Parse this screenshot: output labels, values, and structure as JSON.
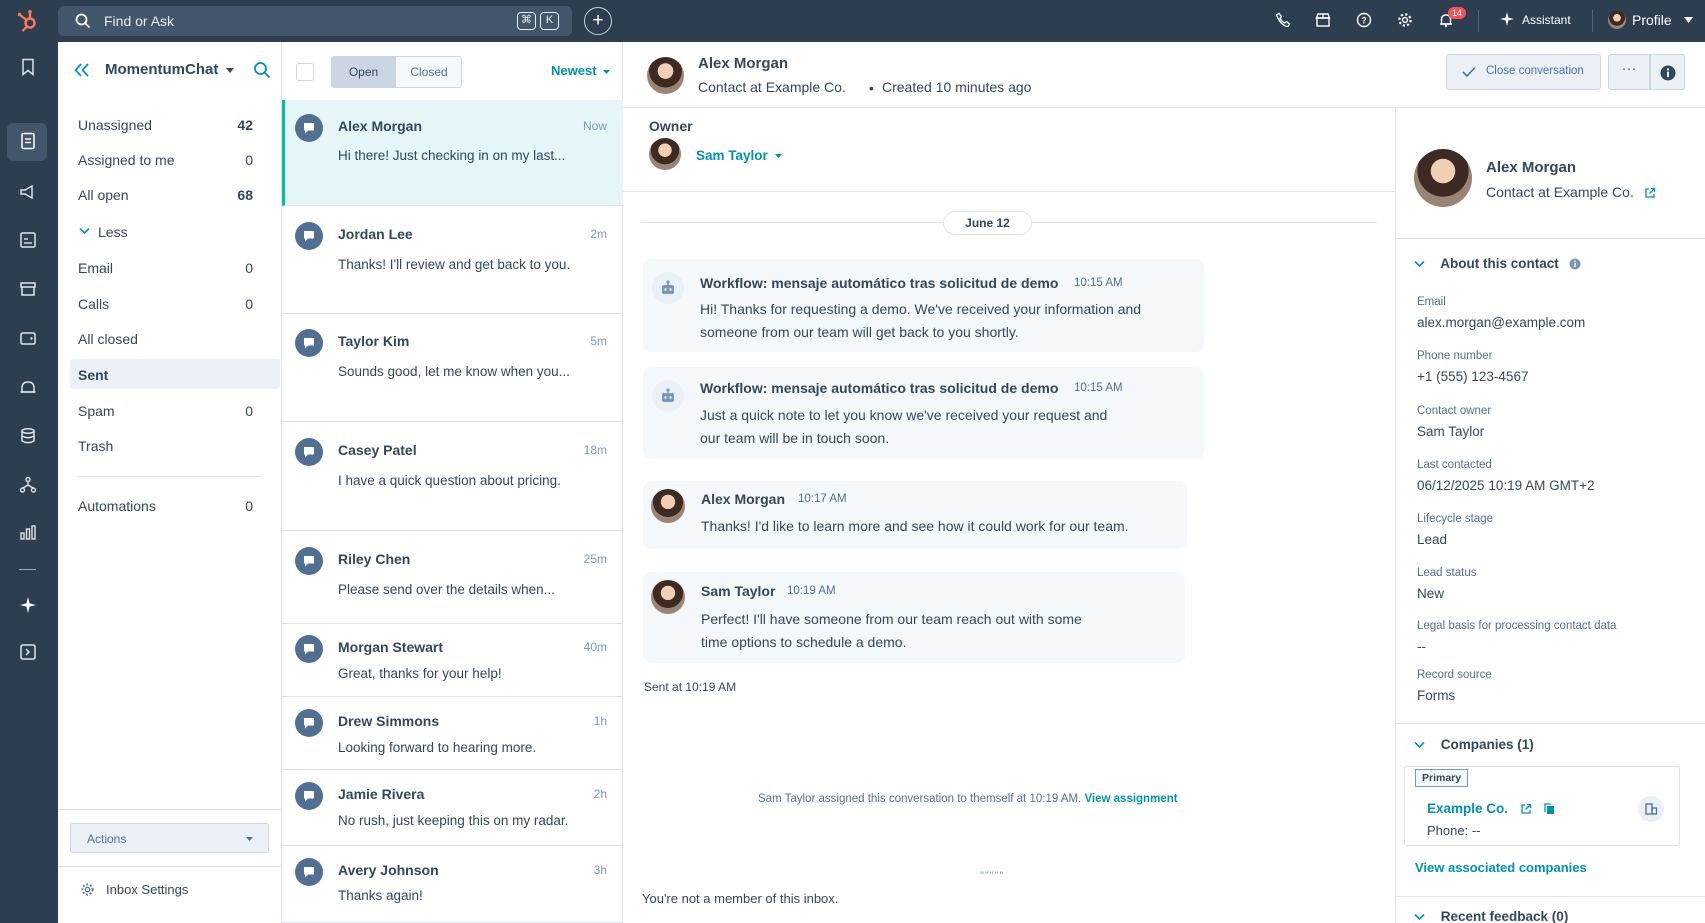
{
  "topbar": {
    "search_placeholder": "Find or Ask",
    "kbd_cmd": "⌘",
    "kbd_k": "K",
    "notifications_count": "14",
    "assistant_label": "Assistant",
    "profile_label": "Profile"
  },
  "sidebar": {
    "inbox_name": "MomentumChat",
    "items": [
      {
        "label": "Unassigned",
        "count": "42"
      },
      {
        "label": "Assigned to me",
        "count": "0"
      },
      {
        "label": "All open",
        "count": "68"
      },
      {
        "label": "Less",
        "count": ""
      },
      {
        "label": "Email",
        "count": "0"
      },
      {
        "label": "Calls",
        "count": "0"
      },
      {
        "label": "All closed",
        "count": ""
      },
      {
        "label": "Sent",
        "count": ""
      },
      {
        "label": "Spam",
        "count": "0"
      },
      {
        "label": "Trash",
        "count": ""
      },
      {
        "label": "Automations",
        "count": "0"
      }
    ],
    "actions_label": "Actions",
    "settings_label": "Inbox Settings"
  },
  "conv_list": {
    "tab_open": "Open",
    "tab_closed": "Closed",
    "sort_label": "Newest",
    "items": [
      {
        "name": "Alex Morgan",
        "time": "Now",
        "preview": "Hi there! Just checking in on my last..."
      },
      {
        "name": "Jordan Lee",
        "time": "2m",
        "preview": "Thanks! I'll review and get back to you."
      },
      {
        "name": "Taylor Kim",
        "time": "5m",
        "preview": "Sounds good, let me know when you..."
      },
      {
        "name": "Casey Patel",
        "time": "18m",
        "preview": "I have a quick question about pricing."
      },
      {
        "name": "Riley Chen",
        "time": "25m",
        "preview": "Please send over the details when..."
      },
      {
        "name": "Morgan Stewart",
        "time": "40m",
        "preview": "Great, thanks for your help!"
      },
      {
        "name": "Drew Simmons",
        "time": "1h",
        "preview": "Looking forward to hearing more."
      },
      {
        "name": "Jamie Rivera",
        "time": "2h",
        "preview": "No rush, just keeping this on my radar."
      },
      {
        "name": "Avery Johnson",
        "time": "3h",
        "preview": "Thanks again!"
      }
    ]
  },
  "thread": {
    "contact_name": "Alex Morgan",
    "contact_meta": "Contact at Example Co.",
    "created": "Created 10 minutes ago",
    "close_label": "Close conversation",
    "more_label": "···",
    "owner_label": "Owner",
    "owner_name": "Sam Taylor",
    "date_pill": "June 12",
    "messages": [
      {
        "sender": "Workflow: mensaje automático tras solicitud de demo",
        "time": "10:15 AM",
        "body": [
          "Hi! Thanks for requesting a demo. We've received your information and",
          "someone from our team will get back to you shortly."
        ]
      },
      {
        "sender": "Workflow: mensaje automático tras solicitud de demo",
        "time": "10:15 AM",
        "body": [
          "Just a quick note to let you know we've received your request and",
          "our team will be in touch soon."
        ]
      },
      {
        "sender": "Alex Morgan",
        "time": "10:17 AM",
        "body": [
          "Thanks! I'd like to learn more and see how it could work for our team."
        ]
      },
      {
        "sender": "Sam Taylor",
        "time": "10:19 AM",
        "body": [
          "Perfect! I'll have someone from our team reach out with some",
          "time options to schedule a demo."
        ]
      }
    ],
    "sent_at": "Sent at 10:19 AM",
    "assignment_text": "Sam Taylor assigned this conversation to themself at 10:19 AM.",
    "assignment_link": "View assignment",
    "resize_glyph": "\"\"\"\"\"",
    "not_member": "You're not a member of this inbox."
  },
  "contact_panel": {
    "name": "Alex Morgan",
    "meta": "Contact at Example Co.",
    "about_title": "About this contact",
    "fields": [
      {
        "label": "Email",
        "value": "alex.morgan@example.com"
      },
      {
        "label": "Phone number",
        "value": "+1 (555) 123-4567"
      },
      {
        "label": "Contact owner",
        "value": "Sam Taylor"
      },
      {
        "label": "Last contacted",
        "value": "06/12/2025 10:19 AM GMT+2"
      },
      {
        "label": "Lifecycle stage",
        "value": "Lead"
      },
      {
        "label": "Lead status",
        "value": "New"
      },
      {
        "label": "Legal basis for processing contact data",
        "value": "--"
      },
      {
        "label": "Record source",
        "value": "Forms"
      }
    ],
    "companies_title": "Companies (1)",
    "primary_tag": "Primary",
    "company_name": "Example Co.",
    "company_phone": "Phone: --",
    "view_companies": "View associated companies",
    "feedback_title": "Recent feedback (0)"
  },
  "colors": {
    "nav_bg": "#2d3e50",
    "accent_teal": "#00bda5",
    "link_blue": "#0091ae",
    "notification_red": "#f2545b"
  }
}
